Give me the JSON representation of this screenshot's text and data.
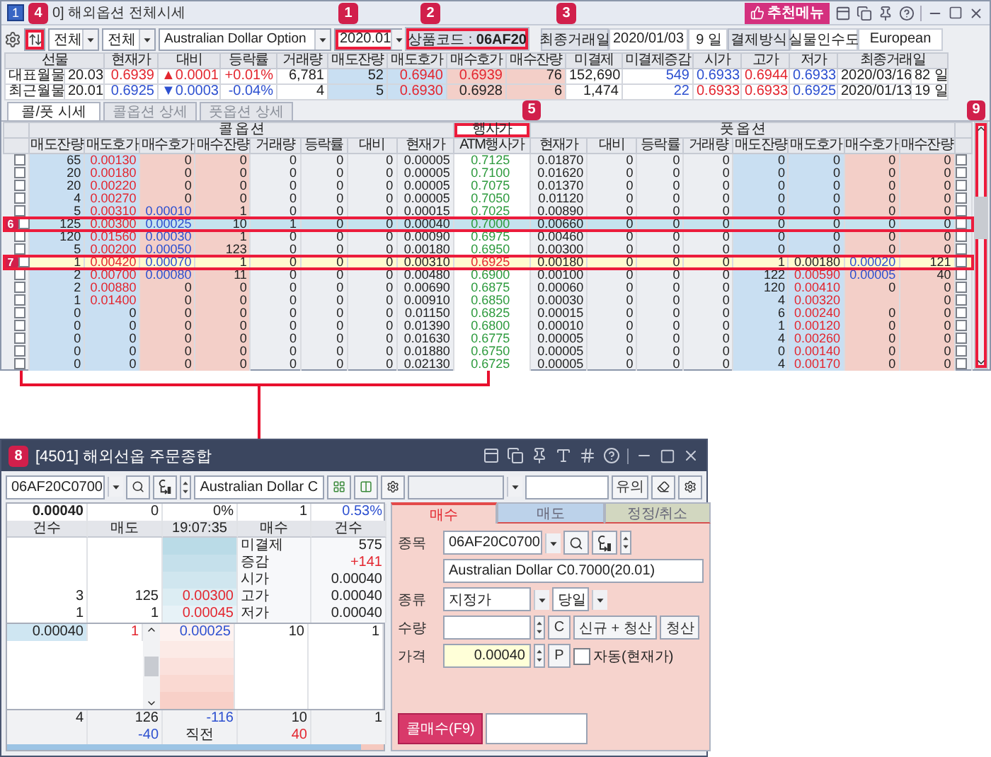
{
  "window": {
    "number": "1",
    "title": "0] 해외옵션 전체시세",
    "recommend_button": "추천메뉴"
  },
  "filters": {
    "sort_callout": "4",
    "selects": [
      {
        "value": "전체"
      },
      {
        "value": "전체"
      },
      {
        "value": "Australian Dollar Option"
      },
      {
        "value": "2020.01",
        "callout": "1"
      }
    ],
    "code_text": "상품코드 : **06AF20**",
    "code_callout": "2",
    "info_callout": "3",
    "last_trade_label": "최종거래일",
    "last_trade_date": "2020/01/03",
    "days_left": "9 일",
    "settlement_label": "결제방식",
    "settlement": "실물인수도",
    "exercise_style": "European"
  },
  "futures": {
    "head": "선물",
    "columns": [
      {
        "label": "현재가"
      },
      {
        "label": "대비"
      },
      {
        "label": "등락률"
      },
      {
        "label": "거래량"
      },
      {
        "label": "매도잔량",
        "color": "#c9dff2"
      },
      {
        "label": "매도호가",
        "color": "#c9dff2"
      },
      {
        "label": "매수호가",
        "color": "#f3cfc8"
      },
      {
        "label": "매수잔량",
        "color": "#f3cfc8"
      },
      {
        "label": "미결제"
      },
      {
        "label": "미결제증감"
      },
      {
        "label": "시가"
      },
      {
        "label": "고가"
      },
      {
        "label": "저가"
      }
    ],
    "last_head": "최종거래일",
    "rows": [
      {
        "name": "대표월물",
        "month": "20.03",
        "cells": [
          {
            "text": "0.6939",
            "color": "#e3262f"
          },
          {
            "text": "0.0001",
            "color": "#e3262f",
            "arrow": "▲"
          },
          {
            "text": "+0.01%",
            "color": "#e3262f"
          },
          "6,781",
          "52",
          {
            "text": "0.6940",
            "color": "#e3262f"
          },
          {
            "text": "0.6939",
            "color": "#e3262f"
          },
          "76",
          "152,690",
          {
            "text": "549",
            "color": "#2d50d0"
          },
          {
            "text": "0.6933",
            "color": "#2d50d0"
          },
          {
            "text": "0.6944",
            "color": "#e3262f"
          },
          {
            "text": "0.6933",
            "color": "#2d50d0"
          }
        ],
        "last_date": "2020/03/16",
        "last_days": "82 일"
      },
      {
        "name": "최근월물",
        "month": "20.01",
        "cells": [
          {
            "text": "0.6925",
            "color": "#2d50d0"
          },
          {
            "text": "0.0003",
            "color": "#2d50d0",
            "arrow": "▼"
          },
          {
            "text": "-0.04%",
            "color": "#2d50d0"
          },
          "4",
          "5",
          {
            "text": "0.6930",
            "color": "#e3262f"
          },
          "0.6928",
          "6",
          "1,474",
          {
            "text": "22",
            "color": "#2d50d0"
          },
          {
            "text": "0.6933",
            "color": "#e3262f"
          },
          {
            "text": "0.6933",
            "color": "#e3262f"
          },
          {
            "text": "0.6925",
            "color": "#2d50d0"
          }
        ],
        "last_date": "2020/01/13",
        "last_days": "19 일"
      }
    ]
  },
  "tabs": [
    {
      "label": "콜/풋 시세",
      "selected": true
    },
    {
      "label": "콜옵션 상세",
      "selected": false
    },
    {
      "label": "풋옵션 상세",
      "selected": false
    }
  ],
  "options": {
    "call_title": "콜 옵 션",
    "strike_title": "행사가",
    "strike_callout": "5",
    "put_title": "풋 옵 션",
    "scroll_callout": "9",
    "call_columns": [
      {
        "label": "매도잔량",
        "color": "#c9dff2"
      },
      {
        "label": "매도호가",
        "color": "#c9dff2"
      },
      {
        "label": "매수호가",
        "color": "#f3cfc8"
      },
      {
        "label": "매수잔량",
        "color": "#f3cfc8"
      },
      {
        "label": "거래량"
      },
      {
        "label": "등락률"
      },
      {
        "label": "대비"
      },
      {
        "label": "현재가"
      }
    ],
    "strike_column": "ATM행사가",
    "put_columns": [
      {
        "label": "현재가"
      },
      {
        "label": "대비"
      },
      {
        "label": "등락률"
      },
      {
        "label": "거래량"
      },
      {
        "label": "매도잔량",
        "color": "#c9dff2"
      },
      {
        "label": "매도호가",
        "color": "#c9dff2"
      },
      {
        "label": "매수호가",
        "color": "#f3cfc8"
      },
      {
        "label": "매수잔량",
        "color": "#f3cfc8"
      }
    ],
    "rows": [
      {
        "selected": false,
        "atm": false,
        "call_checked": false,
        "call": {
          "ask_qty": "65",
          "ask": {
            "text": "0.00130",
            "color": "#e3262f"
          },
          "bid": "0",
          "bid_qty": "0",
          "volume": "0",
          "rate": "0",
          "change": "0",
          "price": "0.00005"
        },
        "strike": "0.7125",
        "put": {
          "price": "0.01870",
          "change": "0",
          "rate": "0",
          "volume": "0",
          "ask_qty": "0",
          "ask": "0",
          "bid": "0",
          "bid_qty": "0"
        },
        "put_checked": false
      },
      {
        "selected": false,
        "atm": false,
        "call_checked": false,
        "call": {
          "ask_qty": "20",
          "ask": {
            "text": "0.00180",
            "color": "#e3262f"
          },
          "bid": "0",
          "bid_qty": "0",
          "volume": "0",
          "rate": "0",
          "change": "0",
          "price": "0.00005"
        },
        "strike": "0.7100",
        "put": {
          "price": "0.01620",
          "change": "0",
          "rate": "0",
          "volume": "0",
          "ask_qty": "0",
          "ask": "0",
          "bid": "0",
          "bid_qty": "0"
        },
        "put_checked": false
      },
      {
        "selected": false,
        "atm": false,
        "call_checked": false,
        "call": {
          "ask_qty": "20",
          "ask": {
            "text": "0.00220",
            "color": "#e3262f"
          },
          "bid": "0",
          "bid_qty": "0",
          "volume": "0",
          "rate": "0",
          "change": "0",
          "price": "0.00005"
        },
        "strike": "0.7075",
        "put": {
          "price": "0.01370",
          "change": "0",
          "rate": "0",
          "volume": "0",
          "ask_qty": "0",
          "ask": "0",
          "bid": "0",
          "bid_qty": "0"
        },
        "put_checked": false
      },
      {
        "selected": false,
        "atm": false,
        "call_checked": false,
        "call": {
          "ask_qty": "4",
          "ask": {
            "text": "0.00270",
            "color": "#e3262f"
          },
          "bid": "0",
          "bid_qty": "0",
          "volume": "0",
          "rate": "0",
          "change": "0",
          "price": "0.00005"
        },
        "strike": "0.7050",
        "put": {
          "price": "0.01120",
          "change": "0",
          "rate": "0",
          "volume": "0",
          "ask_qty": "0",
          "ask": "0",
          "bid": "0",
          "bid_qty": "0"
        },
        "put_checked": false
      },
      {
        "selected": false,
        "atm": false,
        "call_checked": false,
        "call": {
          "ask_qty": "5",
          "ask": {
            "text": "0.00310",
            "color": "#e3262f"
          },
          "bid": {
            "text": "0.00010",
            "color": "#2d50d0"
          },
          "bid_qty": "1",
          "volume": "0",
          "rate": "0",
          "change": "0",
          "price": "0.00015"
        },
        "strike": "0.7025",
        "put": {
          "price": "0.00890",
          "change": "0",
          "rate": "0",
          "volume": "0",
          "ask_qty": "0",
          "ask": "0",
          "bid": "0",
          "bid_qty": "0"
        },
        "put_checked": false
      },
      {
        "selected": true,
        "atm": false,
        "callout": "6",
        "call_checked": false,
        "call": {
          "ask_qty": "125",
          "ask": {
            "text": "0.00300",
            "color": "#e3262f"
          },
          "bid": {
            "text": "0.00025",
            "color": "#2d50d0"
          },
          "bid_qty": "10",
          "volume": "1",
          "rate": "0",
          "change": "0",
          "price": "0.00040"
        },
        "strike": "0.7000",
        "put": {
          "price": "0.00660",
          "change": "0",
          "rate": "0",
          "volume": "0",
          "ask_qty": "0",
          "ask": "0",
          "bid": "0",
          "bid_qty": "0"
        },
        "put_checked": false
      },
      {
        "selected": false,
        "atm": false,
        "call_checked": false,
        "call": {
          "ask_qty": "120",
          "ask": {
            "text": "0.01560",
            "color": "#e3262f"
          },
          "bid": {
            "text": "0.00030",
            "color": "#2d50d0"
          },
          "bid_qty": "1",
          "volume": "0",
          "rate": "0",
          "change": "0",
          "price": "0.00090"
        },
        "strike": "0.6975",
        "put": {
          "price": "0.00460",
          "change": "0",
          "rate": "0",
          "volume": "0",
          "ask_qty": "0",
          "ask": "0",
          "bid": "0",
          "bid_qty": "0"
        },
        "put_checked": false
      },
      {
        "selected": false,
        "atm": false,
        "call_checked": false,
        "call": {
          "ask_qty": "5",
          "ask": {
            "text": "0.00200",
            "color": "#e3262f"
          },
          "bid": {
            "text": "0.00050",
            "color": "#2d50d0"
          },
          "bid_qty": "123",
          "volume": "0",
          "rate": "0",
          "change": "0",
          "price": "0.00180"
        },
        "strike": "0.6950",
        "put": {
          "price": "0.00300",
          "change": "0",
          "rate": "0",
          "volume": "0",
          "ask_qty": "0",
          "ask": "0",
          "bid": "0",
          "bid_qty": "0"
        },
        "put_checked": false
      },
      {
        "selected": false,
        "atm": true,
        "callout": "7",
        "call_checked": false,
        "call": {
          "ask_qty": "1",
          "ask": {
            "text": "0.00420",
            "color": "#e3262f"
          },
          "bid": {
            "text": "0.00070",
            "color": "#2d50d0"
          },
          "bid_qty": "1",
          "volume": "0",
          "rate": "0",
          "change": "0",
          "price": "0.00310"
        },
        "strike": "0.6925",
        "put": {
          "price": "0.00180",
          "change": "0",
          "rate": "0",
          "volume": "0",
          "ask_qty": "1",
          "ask": "0.00180",
          "bid": {
            "text": "0.00020",
            "color": "#2d50d0"
          },
          "bid_qty": "121"
        },
        "put_checked": false
      },
      {
        "selected": false,
        "atm": false,
        "call_checked": false,
        "call": {
          "ask_qty": "2",
          "ask": {
            "text": "0.00700",
            "color": "#e3262f"
          },
          "bid": {
            "text": "0.00080",
            "color": "#2d50d0"
          },
          "bid_qty": "11",
          "volume": "0",
          "rate": "0",
          "change": "0",
          "price": "0.00480"
        },
        "strike": "0.6900",
        "put": {
          "price": "0.00100",
          "change": "0",
          "rate": "0",
          "volume": "0",
          "ask_qty": "122",
          "ask": {
            "text": "0.00590",
            "color": "#e3262f"
          },
          "bid": {
            "text": "0.00005",
            "color": "#2d50d0"
          },
          "bid_qty": "40"
        },
        "put_checked": false
      },
      {
        "selected": false,
        "atm": false,
        "call_checked": false,
        "call": {
          "ask_qty": "2",
          "ask": {
            "text": "0.00880",
            "color": "#e3262f"
          },
          "bid": "0",
          "bid_qty": "0",
          "volume": "0",
          "rate": "0",
          "change": "0",
          "price": "0.00690"
        },
        "strike": "0.6875",
        "put": {
          "price": "0.00060",
          "change": "0",
          "rate": "0",
          "volume": "0",
          "ask_qty": "120",
          "ask": {
            "text": "0.00410",
            "color": "#e3262f"
          },
          "bid": "0",
          "bid_qty": "0"
        },
        "put_checked": false
      },
      {
        "selected": false,
        "atm": false,
        "call_checked": false,
        "call": {
          "ask_qty": "1",
          "ask": {
            "text": "0.01400",
            "color": "#e3262f"
          },
          "bid": "0",
          "bid_qty": "0",
          "volume": "0",
          "rate": "0",
          "change": "0",
          "price": "0.00910"
        },
        "strike": "0.6850",
        "put": {
          "price": "0.00030",
          "change": "0",
          "rate": "0",
          "volume": "0",
          "ask_qty": "4",
          "ask": {
            "text": "0.00320",
            "color": "#e3262f"
          },
          "bid_qty": "0"
        },
        "put_checked": false
      },
      {
        "selected": false,
        "atm": false,
        "call_checked": false,
        "call": {
          "ask_qty": "0",
          "ask": "0",
          "bid": "0",
          "bid_qty": "0",
          "volume": "0",
          "rate": "0",
          "change": "0",
          "price": "0.01150"
        },
        "strike": "0.6825",
        "put": {
          "price": "0.00015",
          "change": "0",
          "rate": "0",
          "volume": "0",
          "ask_qty": "6",
          "ask": {
            "text": "0.00240",
            "color": "#e3262f"
          },
          "bid": "0",
          "bid_qty": "0"
        },
        "put_checked": false
      },
      {
        "selected": false,
        "atm": false,
        "call_checked": false,
        "call": {
          "ask_qty": "0",
          "ask": "0",
          "bid": "0",
          "bid_qty": "0",
          "volume": "0",
          "rate": "0",
          "change": "0",
          "price": "0.01390"
        },
        "strike": "0.6800",
        "put": {
          "price": "0.00010",
          "change": "0",
          "rate": "0",
          "volume": "0",
          "ask_qty": "1",
          "ask": {
            "text": "0.00120",
            "color": "#e3262f"
          },
          "bid": "0",
          "bid_qty": "0"
        },
        "put_checked": false
      },
      {
        "selected": false,
        "atm": false,
        "call_checked": false,
        "call": {
          "ask_qty": "0",
          "ask": "0",
          "bid": "0",
          "bid_qty": "0",
          "volume": "0",
          "rate": "0",
          "change": "0",
          "price": "0.01630"
        },
        "strike": "0.6775",
        "put": {
          "price": "0.00005",
          "change": "0",
          "rate": "0",
          "volume": "0",
          "ask_qty": "4",
          "ask": {
            "text": "0.00260",
            "color": "#e3262f"
          },
          "bid": "0",
          "bid_qty": "0"
        },
        "put_checked": false
      },
      {
        "selected": false,
        "atm": false,
        "call_checked": false,
        "call": {
          "ask_qty": "0",
          "ask": "0",
          "bid": "0",
          "bid_qty": "0",
          "volume": "0",
          "rate": "0",
          "change": "0",
          "price": "0.01880"
        },
        "strike": "0.6750",
        "put": {
          "price": "0.00005",
          "change": "0",
          "rate": "0",
          "volume": "0",
          "ask_qty": "0",
          "ask": {
            "text": "0.00140",
            "color": "#e3262f"
          },
          "bid": "0",
          "bid_qty": "0"
        },
        "put_checked": false
      },
      {
        "selected": false,
        "atm": false,
        "call_checked": false,
        "call": {
          "ask_qty": "0",
          "ask": "0",
          "bid": "0",
          "bid_qty": "0",
          "volume": "0",
          "rate": "0",
          "change": "0",
          "price": "0.02130"
        },
        "strike": "0.6725",
        "put": {
          "price": "0.00005",
          "change": "0",
          "rate": "0",
          "volume": "0",
          "ask_qty": "4",
          "ask": {
            "text": "0.00170",
            "color": "#e3262f"
          },
          "bid": "0",
          "bid_qty": "0"
        },
        "put_checked": false
      }
    ]
  },
  "order_window": {
    "callout": "8",
    "title": "[4501] 해외선옵 주문종합",
    "code": "06AF20C0700",
    "name": "Australian Dollar C",
    "notice_button": "유의"
  },
  "book": {
    "quote": [
      {
        "text": "0.00040",
        "bold": true
      },
      {
        "text": "0"
      },
      {
        "text": "0%"
      },
      {
        "text": "1"
      },
      {
        "text": "0.53%",
        "color": "#2d50d0"
      }
    ],
    "headers": [
      "건수",
      "매도",
      "19:07:35",
      "매수",
      "건수"
    ],
    "ask_rows": [
      {},
      {},
      {},
      {
        "count": "3",
        "qty": "125",
        "price": "0.00300"
      },
      {
        "count": "1",
        "qty": "1",
        "price": "0.00045"
      }
    ],
    "info": [
      {
        "label": "미결제",
        "value": "575"
      },
      {
        "label": "증감",
        "value": "+141",
        "color": "#e3262f"
      },
      {
        "label": "시가",
        "value": "0.00040"
      },
      {
        "label": "고가",
        "value": "0.00040"
      },
      {
        "label": "저가",
        "value": "0.00040"
      }
    ],
    "fills": [
      {
        "price": "0.00040",
        "qty": "1"
      }
    ],
    "bid_rows": [
      {
        "price": "0.00025",
        "qty": "10",
        "count": "1"
      },
      {},
      {},
      {},
      {}
    ],
    "footer": [
      {
        "sell_count": {
          "text": "4"
        },
        "sell_qty": {
          "text": "126"
        },
        "center": {
          "text": "-116",
          "color": "#2d50d0"
        },
        "buy_qty": {
          "text": "10"
        },
        "buy_count": {
          "text": "1"
        }
      },
      {
        "sell_qty": {
          "text": "-40",
          "color": "#2d50d0"
        },
        "center": {
          "text": "직전"
        },
        "buy_qty": {
          "text": "40",
          "color": "#e3262f"
        }
      }
    ],
    "ratio_bar": {
      "level": 0.94
    }
  },
  "order_form": {
    "tabs": [
      {
        "label": "매수",
        "selected": true,
        "color": "#f6d3cd"
      },
      {
        "label": "매도",
        "selected": false,
        "color": "#bcd2ea"
      },
      {
        "label": "정정/취소",
        "selected": false,
        "color": "#d2d7c0"
      }
    ],
    "symbol_label": "종목",
    "symbol": "06AF20C0700",
    "symbol_name": "Australian Dollar C0.7000(20.01)",
    "type_label": "종류",
    "order_type": "지정가",
    "term": "당일",
    "qty_label": "수량",
    "clear_button": "C",
    "new_close_button": "신규 + 청산",
    "close_button": "청산",
    "price_label": "가격",
    "price": "0.00040",
    "price_button": "P",
    "auto_label": "자동(현재가)",
    "auto_checked": false,
    "submit_button": "콜매수(F9)"
  }
}
